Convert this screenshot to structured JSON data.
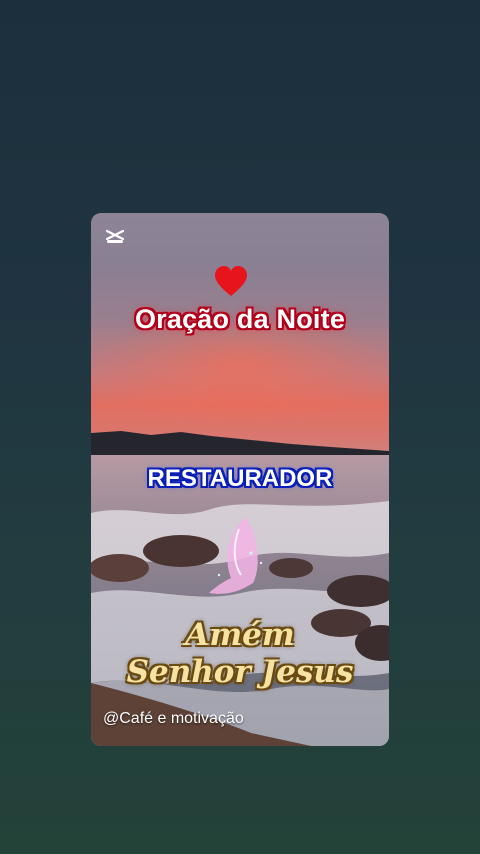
{
  "video": {
    "app_logo": "capcut-icon",
    "heart_icon": "heart-icon",
    "title": "Oração da Noite",
    "subtitle": "RESTAURADOR",
    "blessing_line1": "Amém",
    "blessing_line2": "Senhor Jesus",
    "handle": "@Café e motivação"
  },
  "colors": {
    "background": "#1f3440",
    "title_outline": "#b0001a",
    "subtitle_outline": "#0a1eb8",
    "blessing_text": "#f6e2a2",
    "heart": "#e8141c"
  }
}
